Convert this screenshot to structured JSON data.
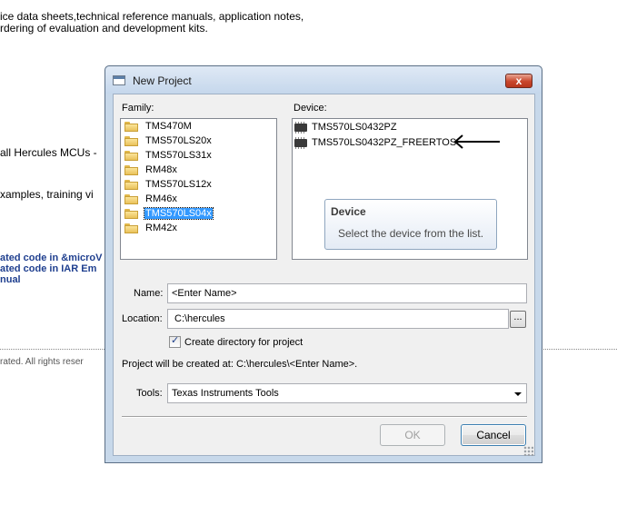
{
  "background": {
    "line1": "ice data sheets,technical reference manuals, application notes,",
    "line2": "rdering of evaluation and development kits.",
    "line3": " all Hercules MCUs -",
    "line4": "xamples, training vi",
    "link1": "ated code in &microV",
    "link2": "ated code in IAR Em",
    "link3": "nual",
    "footer": "rated. All rights reser"
  },
  "dialog": {
    "title": "New Project",
    "close_label": "x",
    "family_label": "Family:",
    "device_label": "Device:",
    "family_items": [
      "TMS470M",
      "TMS570LS20x",
      "TMS570LS31x",
      "RM48x",
      "TMS570LS12x",
      "RM46x",
      "TMS570LS04x",
      "RM42x"
    ],
    "selected_family": "TMS570LS04x",
    "device_items": [
      "TMS570LS0432PZ",
      "TMS570LS0432PZ_FREERTOS"
    ],
    "tooltip": {
      "title": "Device",
      "body": "Select the device from the list."
    },
    "name_label": "Name:",
    "name_value": "<Enter Name>",
    "location_label": "Location:",
    "location_value": "C:\\hercules",
    "browse_label": "...",
    "create_dir_label": "Create directory for project",
    "create_dir_checked": true,
    "project_path_text": "Project will be created at: C:\\hercules\\<Enter Name>.",
    "tools_label": "Tools:",
    "tools_value": "Texas Instruments Tools",
    "ok_label": "OK",
    "cancel_label": "Cancel"
  },
  "icons": {
    "title": "window-icon",
    "family": "folder-icon",
    "device": "chip-icon",
    "annotation": "arrow-left-icon"
  },
  "colors": {
    "selection": "#3399ff",
    "link": "#1f3f8f",
    "close_button": "#c9462c"
  }
}
